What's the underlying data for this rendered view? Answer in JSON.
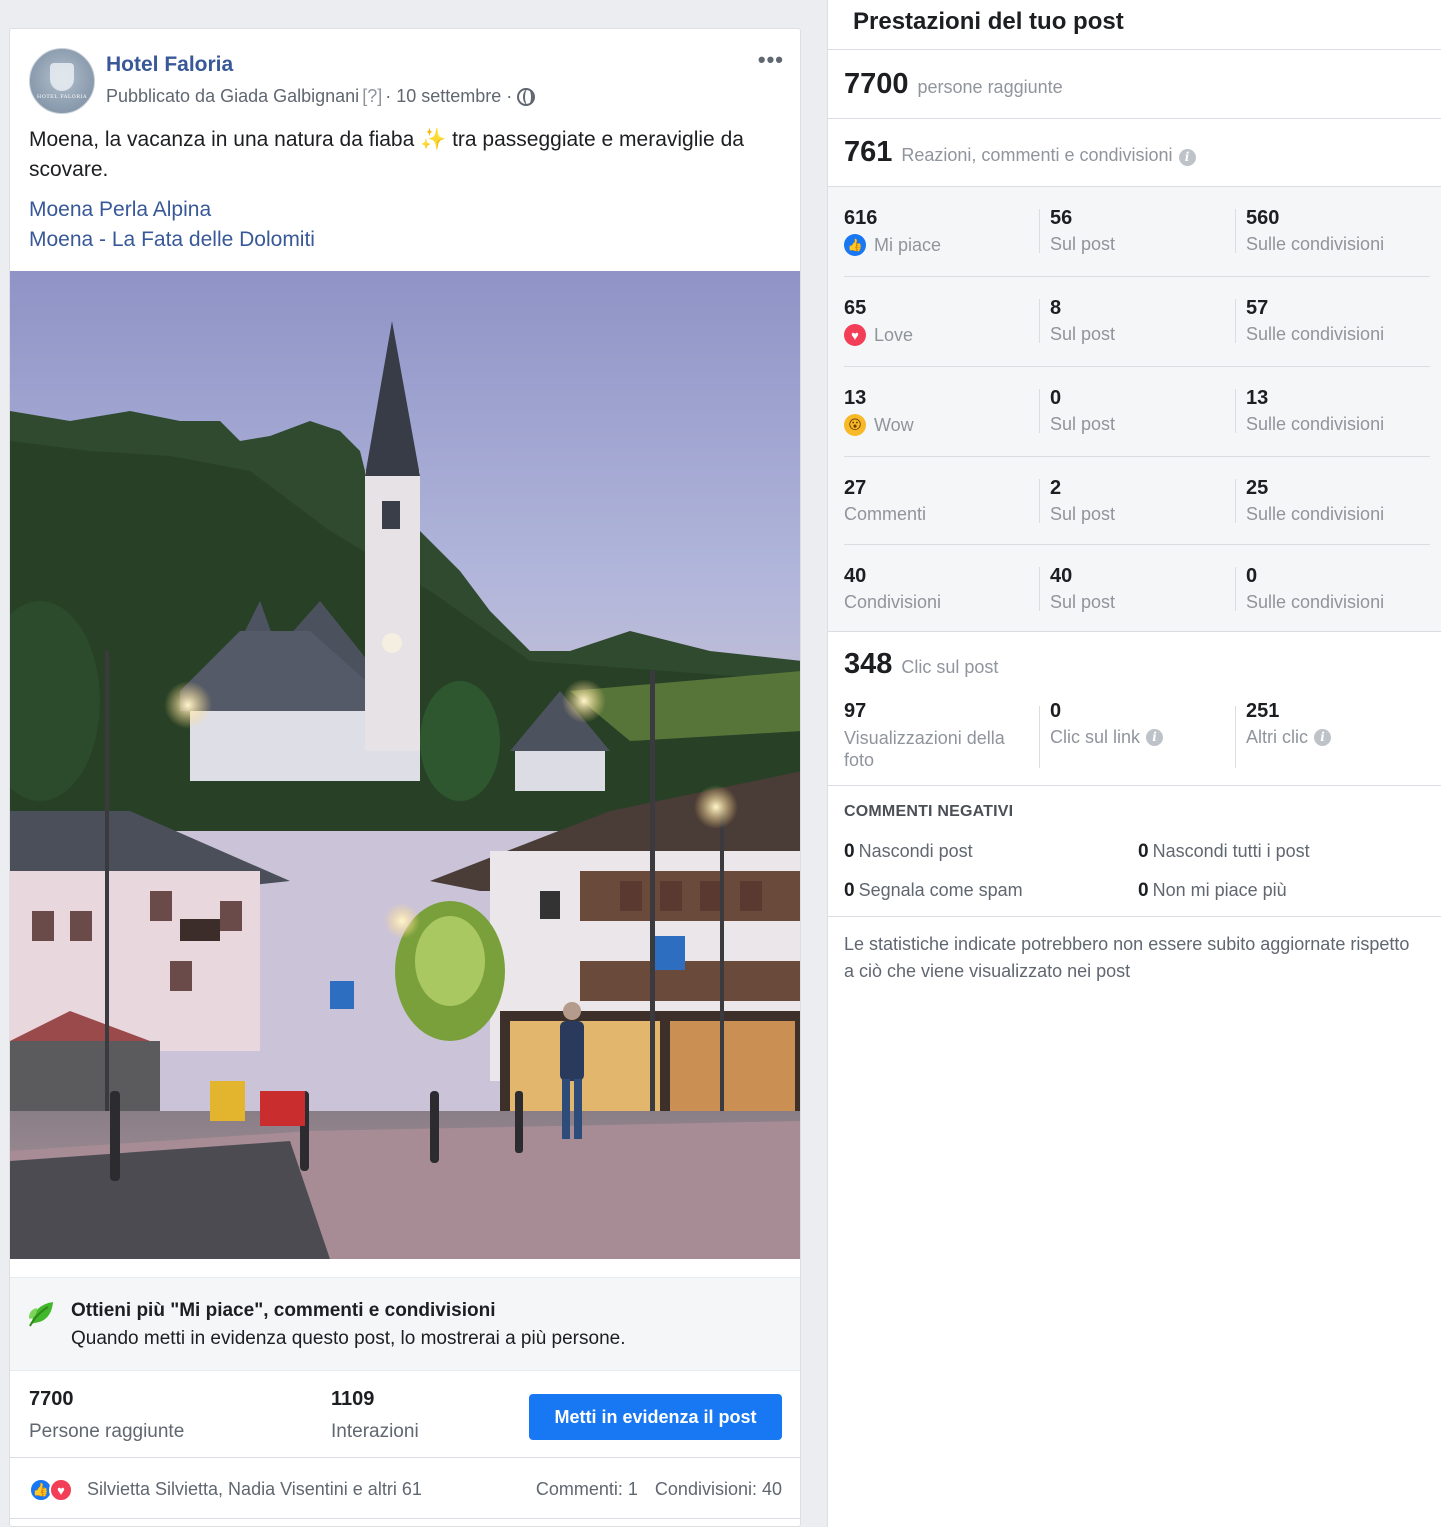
{
  "post": {
    "page_name": "Hotel Faloria",
    "avatar_text": "HOTEL FALORIA",
    "byline_prefix": "Pubblicato da Giada Galbignani",
    "byline_help": "[?]",
    "byline_sep": "·",
    "date": "10 settembre",
    "more_label": "•••",
    "text": "Moena, la vacanza in una natura da fiaba ✨ tra passeggiate e meraviglie da scovare.",
    "links": [
      "Moena Perla Alpina",
      "Moena - La Fata delle Dolomiti"
    ],
    "boost": {
      "title": "Ottieni più \"Mi piace\", commenti e condivisioni",
      "description": "Quando metti in evidenza questo post, lo mostrerai a più persone."
    },
    "stats": {
      "reach_value": "7700",
      "reach_label": "Persone raggiunte",
      "interactions_value": "1109",
      "interactions_label": "Interazioni",
      "boost_button": "Metti in evidenza il post"
    },
    "reactions": {
      "names": "Silvietta Silvietta, Nadia Visentini e altri 61",
      "comments": "Commenti: 1",
      "shares": "Condivisioni: 40"
    }
  },
  "panel": {
    "title": "Prestazioni del tuo post",
    "reach": {
      "value": "7700",
      "label": "persone raggiunte"
    },
    "engagement": {
      "value": "761",
      "label": "Reazioni, commenti e condivisioni"
    },
    "rows": [
      {
        "total": "616",
        "label": "Mi piace",
        "icon": "like-icon",
        "on_post": "56",
        "on_post_label": "Sul post",
        "on_shares": "560",
        "on_shares_label": "Sulle condivisioni"
      },
      {
        "total": "65",
        "label": "Love",
        "icon": "love-icon",
        "on_post": "8",
        "on_post_label": "Sul post",
        "on_shares": "57",
        "on_shares_label": "Sulle condivisioni"
      },
      {
        "total": "13",
        "label": "Wow",
        "icon": "wow-icon",
        "on_post": "0",
        "on_post_label": "Sul post",
        "on_shares": "13",
        "on_shares_label": "Sulle condivisioni"
      },
      {
        "total": "27",
        "label": "Commenti",
        "icon": "",
        "on_post": "2",
        "on_post_label": "Sul post",
        "on_shares": "25",
        "on_shares_label": "Sulle condivisioni"
      },
      {
        "total": "40",
        "label": "Condivisioni",
        "icon": "",
        "on_post": "40",
        "on_post_label": "Sul post",
        "on_shares": "0",
        "on_shares_label": "Sulle condivisioni"
      }
    ],
    "clicks": {
      "value": "348",
      "label": "Clic sul post",
      "photo_views": {
        "value": "97",
        "label": "Visualizzazioni della foto"
      },
      "link_clicks": {
        "value": "0",
        "label": "Clic sul link"
      },
      "other_clicks": {
        "value": "251",
        "label": "Altri clic"
      }
    },
    "negative": {
      "title": "COMMENTI NEGATIVI",
      "hide_post": {
        "value": "0",
        "label": "Nascondi post"
      },
      "hide_all": {
        "value": "0",
        "label": "Nascondi tutti i post"
      },
      "spam": {
        "value": "0",
        "label": "Segnala come spam"
      },
      "unlike": {
        "value": "0",
        "label": "Non mi piace più"
      }
    },
    "disclaimer": "Le statistiche indicate potrebbero non essere subito aggiornate rispetto a ciò che viene visualizzato nei post",
    "info_glyph": "i"
  },
  "colors": {
    "accent": "#1877f2",
    "link": "#385898",
    "love": "#f33e58",
    "wow": "#f7b928"
  }
}
